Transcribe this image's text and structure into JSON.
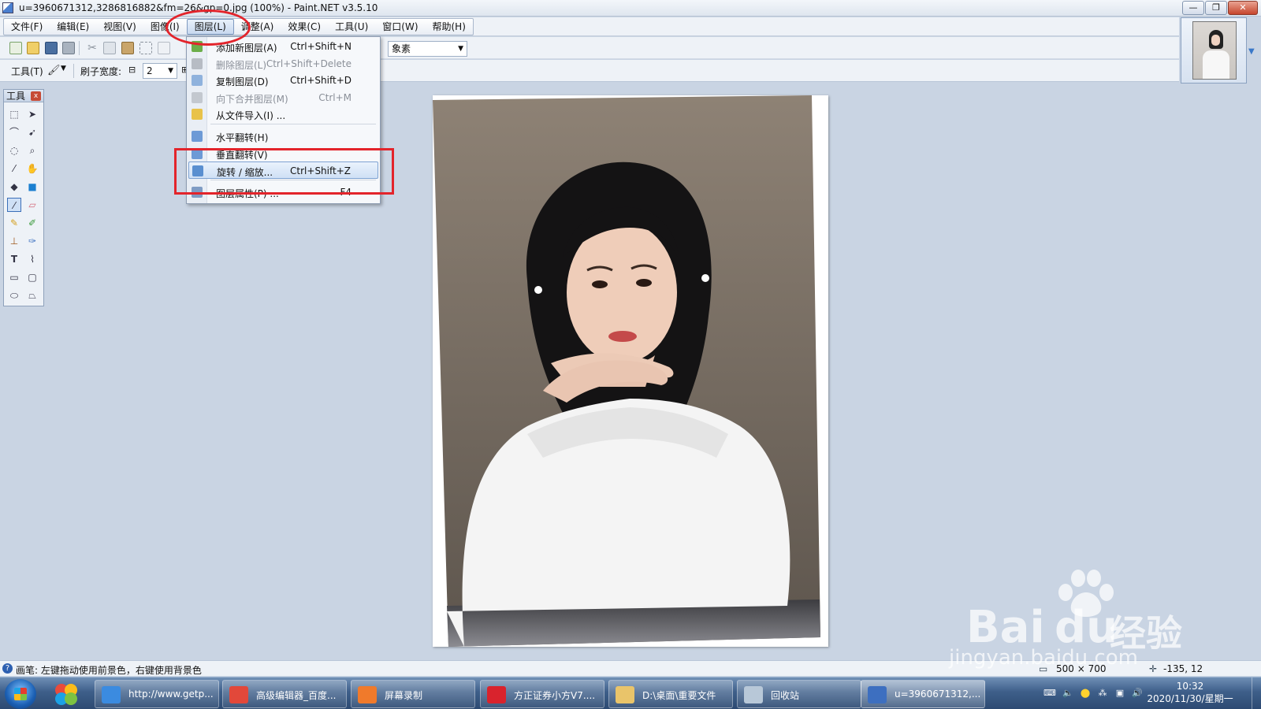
{
  "window": {
    "title": "u=3960671312,3286816882&fm=26&gp=0.jpg (100%) - Paint.NET v3.5.10",
    "minimize": "—",
    "maximize": "❐",
    "close": "✕"
  },
  "menu": {
    "items": [
      {
        "label": "文件(F)"
      },
      {
        "label": "编辑(E)"
      },
      {
        "label": "视图(V)"
      },
      {
        "label": "图像(I)"
      },
      {
        "label": "图层(L)"
      },
      {
        "label": "调整(A)"
      },
      {
        "label": "效果(C)"
      },
      {
        "label": "工具(U)"
      },
      {
        "label": "窗口(W)"
      },
      {
        "label": "帮助(H)"
      }
    ],
    "active_index": 4
  },
  "toolbar": {
    "units_label": "象素",
    "tool_label": "工具(T)",
    "brush_width_label": "刷子宽度:",
    "brush_width_value": "2"
  },
  "layer_menu": {
    "items": [
      {
        "label": "添加新图层(A)",
        "shortcut": "Ctrl+Shift+N",
        "disabled": false,
        "icon": "add-layer-icon",
        "color": "#6cae4a"
      },
      {
        "label": "删除图层(L)",
        "shortcut": "Ctrl+Shift+Delete",
        "disabled": true,
        "icon": "delete-layer-icon",
        "color": "#b7bcc4"
      },
      {
        "label": "复制图层(D)",
        "shortcut": "Ctrl+Shift+D",
        "disabled": false,
        "icon": "duplicate-layer-icon",
        "color": "#8fb2dd"
      },
      {
        "label": "向下合并图层(M)",
        "shortcut": "Ctrl+M",
        "disabled": true,
        "icon": "merge-down-icon",
        "color": "#c3c8cf"
      },
      {
        "label": "从文件导入(I) ...",
        "shortcut": "",
        "disabled": false,
        "icon": "import-file-icon",
        "color": "#e8c24a"
      },
      {
        "label": "水平翻转(H)",
        "shortcut": "",
        "disabled": false,
        "icon": "flip-horizontal-icon",
        "color": "#6d9ad6"
      },
      {
        "label": "垂直翻转(V)",
        "shortcut": "",
        "disabled": false,
        "icon": "flip-vertical-icon",
        "color": "#6d9ad6"
      },
      {
        "label": "旋转 / 缩放...",
        "shortcut": "Ctrl+Shift+Z",
        "disabled": false,
        "highlighted": true,
        "icon": "rotate-zoom-icon",
        "color": "#5a8fd0"
      },
      {
        "label": "图层属性(P) ...",
        "shortcut": "F4",
        "disabled": false,
        "icon": "layer-properties-icon",
        "color": "#7f9cc4"
      }
    ]
  },
  "tools": {
    "header": "工具",
    "close": "x"
  },
  "status": {
    "message": "画笔: 左键拖动使用前景色，右键使用背景色",
    "image_size": "500 × 700",
    "cursor": "-135, 12"
  },
  "taskbar": {
    "buttons": [
      {
        "label": "http://www.getp...",
        "icon": "ie-icon",
        "color": "#3b8be0"
      },
      {
        "label": "高级编辑器_百度...",
        "icon": "chrome-icon",
        "color": "#e2483a"
      },
      {
        "label": "屏幕录制",
        "icon": "screen-record-icon",
        "color": "#f07a2b"
      },
      {
        "label": "方正证券小方V7....",
        "icon": "founder-securities-icon",
        "color": "#d9232d"
      },
      {
        "label": "D:\\桌面\\重要文件",
        "icon": "folder-icon",
        "color": "#e9c46a"
      },
      {
        "label": "回收站",
        "icon": "recycle-bin-icon",
        "color": "#b8c8d8"
      },
      {
        "label": "u=3960671312,...",
        "icon": "paintnet-icon",
        "color": "#3d6fc0",
        "active": true
      }
    ],
    "time": "10:32",
    "date": "2020/11/30/星期一"
  },
  "watermark": {
    "brand": "Bai",
    "brand2": "du",
    "cn": "经验",
    "url": "jingyan.baidu.com"
  },
  "colors": {
    "accent": "#3b6fb8",
    "annotation": "#e3242b"
  }
}
